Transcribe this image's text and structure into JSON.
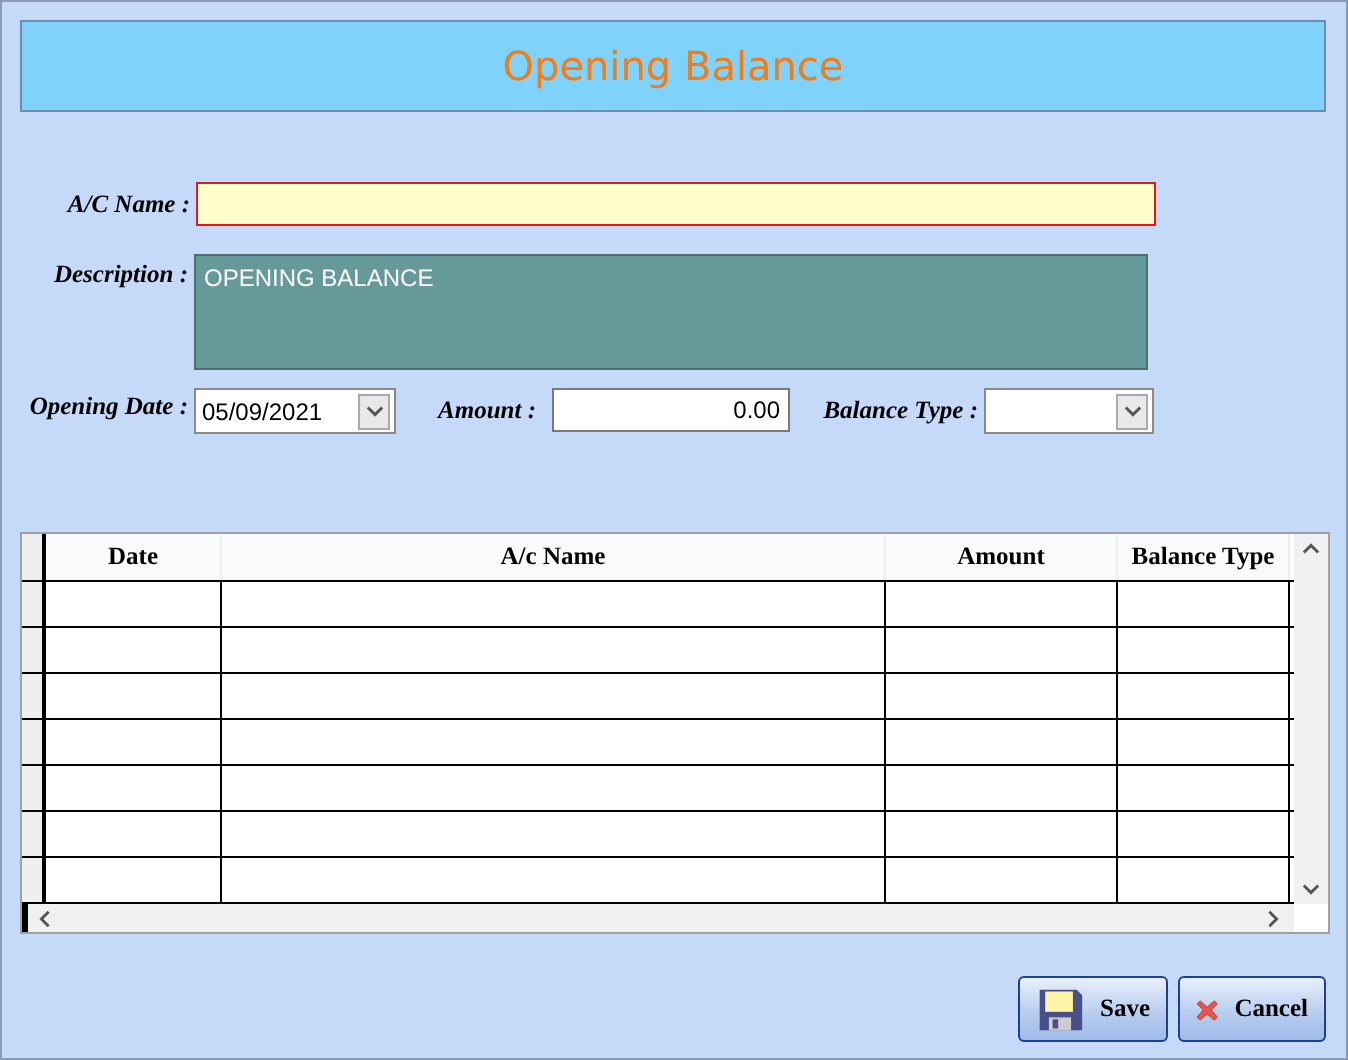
{
  "window": {
    "title": "Opening Balance"
  },
  "form": {
    "ac_name": {
      "label": "A/C Name :"
    },
    "description": {
      "label": "Description :",
      "value": "OPENING BALANCE"
    },
    "opening_date": {
      "label": "Opening Date :",
      "value": "05/09/2021"
    },
    "amount": {
      "label": "Amount :",
      "value": "0.00"
    },
    "balance_type": {
      "label": "Balance Type :"
    }
  },
  "table": {
    "columns": [
      "Date",
      "A/c Name",
      "Amount",
      "Balance Type"
    ]
  },
  "buttons": [
    {
      "kind": "save",
      "label": "Save"
    },
    {
      "kind": "cancel",
      "label": "Cancel"
    }
  ]
}
